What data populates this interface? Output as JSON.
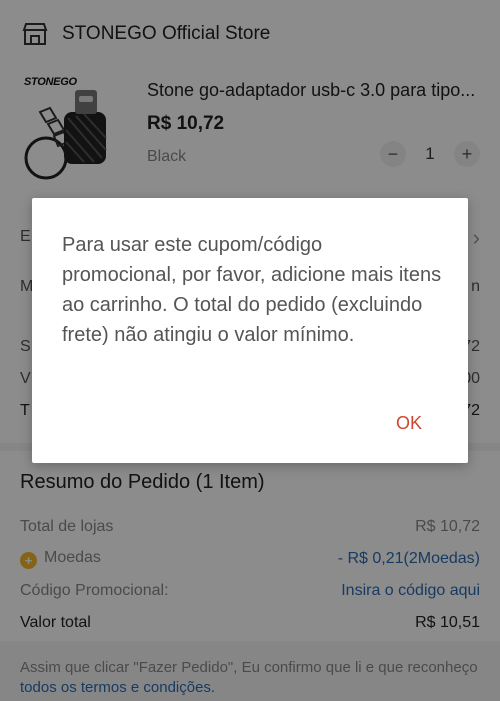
{
  "store": {
    "name": "STONEGO Official Store",
    "icon": "store-icon"
  },
  "product": {
    "brand": "STONEGO",
    "title": "Stone go-adaptador usb-c 3.0 para tipo...",
    "price": "R$ 10,72",
    "variant": "Black",
    "quantity": "1",
    "minus": "−",
    "plus": "+"
  },
  "behind": {
    "row1_label": "E",
    "row1_value": "›",
    "row2_label": "M",
    "row2_value": "n",
    "row3_label": "S",
    "row3_value": "72",
    "row4_label": "V",
    "row4_value": "00",
    "row5_label": "T",
    "row5_value": "72"
  },
  "summary": {
    "title": "Resumo do Pedido (1 Item)",
    "store_total_label": "Total de lojas",
    "store_total_value": "R$ 10,72",
    "coins_label": "Moedas",
    "coins_value": "- R$ 0,21(2Moedas)",
    "promo_label": "Código Promocional:",
    "promo_value": "Insira o código aqui",
    "total_label": "Valor total",
    "total_value": "R$ 10,51"
  },
  "footer": {
    "text": "Assim que clicar \"Fazer Pedido\", Eu confirmo que li e que reconheço ",
    "link": "todos os termos e condições."
  },
  "dialog": {
    "message": "Para usar este cupom/código promocional, por favor, adicione mais itens ao carrinho. O total do pedido (excluindo frete) não atingiu o valor mínimo.",
    "ok_label": "OK"
  },
  "colors": {
    "accent": "#d0462f",
    "link": "#2b6cb0",
    "coin": "#f3b72c"
  }
}
